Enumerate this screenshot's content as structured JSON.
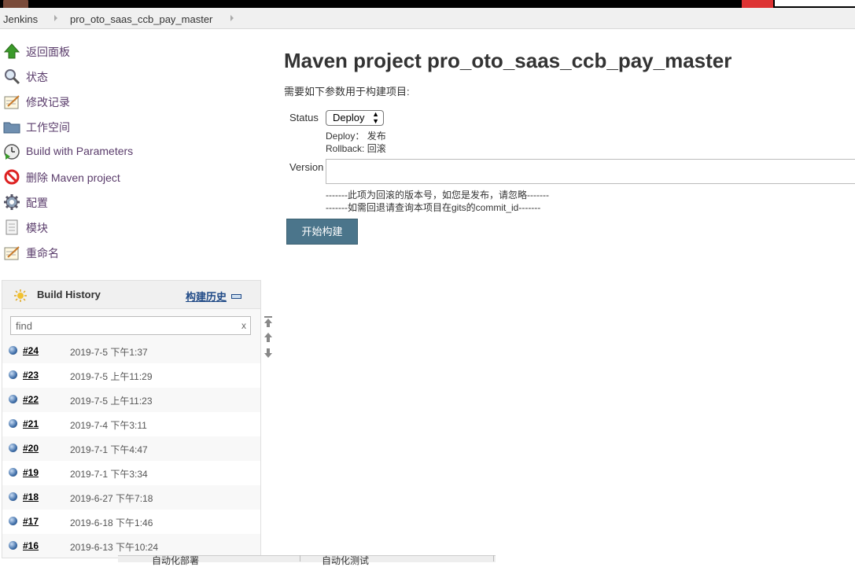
{
  "breadcrumb": {
    "items": [
      "Jenkins",
      "pro_oto_saas_ccb_pay_master"
    ]
  },
  "sidebar": {
    "items": [
      {
        "label": "返回面板",
        "icon": "up-arrow-icon"
      },
      {
        "label": "状态",
        "icon": "search-icon"
      },
      {
        "label": "修改记录",
        "icon": "notepad-icon"
      },
      {
        "label": "工作空间",
        "icon": "folder-icon"
      },
      {
        "label": "Build with Parameters",
        "icon": "clock-play-icon"
      },
      {
        "label": "删除 Maven project",
        "icon": "no-entry-icon"
      },
      {
        "label": "配置",
        "icon": "gear-icon"
      },
      {
        "label": "模块",
        "icon": "document-icon"
      },
      {
        "label": "重命名",
        "icon": "notepad-icon"
      }
    ]
  },
  "build_history": {
    "title": "Build History",
    "link": "构建历史",
    "find_placeholder": "find",
    "clear": "x",
    "builds": [
      {
        "number": "#24",
        "date": "2019-7-5 下午1:37"
      },
      {
        "number": "#23",
        "date": "2019-7-5 上午11:29"
      },
      {
        "number": "#22",
        "date": "2019-7-5 上午11:23"
      },
      {
        "number": "#21",
        "date": "2019-7-4 下午3:11"
      },
      {
        "number": "#20",
        "date": "2019-7-1 下午4:47"
      },
      {
        "number": "#19",
        "date": "2019-7-1 下午3:34"
      },
      {
        "number": "#18",
        "date": "2019-6-27 下午7:18"
      },
      {
        "number": "#17",
        "date": "2019-6-18 下午1:46"
      },
      {
        "number": "#16",
        "date": "2019-6-13 下午10:24"
      }
    ]
  },
  "main": {
    "title": "Maven project pro_oto_saas_ccb_pay_master",
    "description": "需要如下参数用于构建项目:",
    "status_label": "Status",
    "status_value": "Deploy",
    "status_hint_1": "Deploy： 发布",
    "status_hint_2": "Rollback: 回滚",
    "version_label": "Version",
    "version_hint_1": "-------此项为回滚的版本号，如您是发布，请忽略-------",
    "version_hint_2": "-------如需回退请查询本项目在gits的commit_id-------",
    "submit_label": "开始构建"
  },
  "bottom": {
    "tab_1": "自动化部署",
    "tab_2": "自动化测试"
  }
}
